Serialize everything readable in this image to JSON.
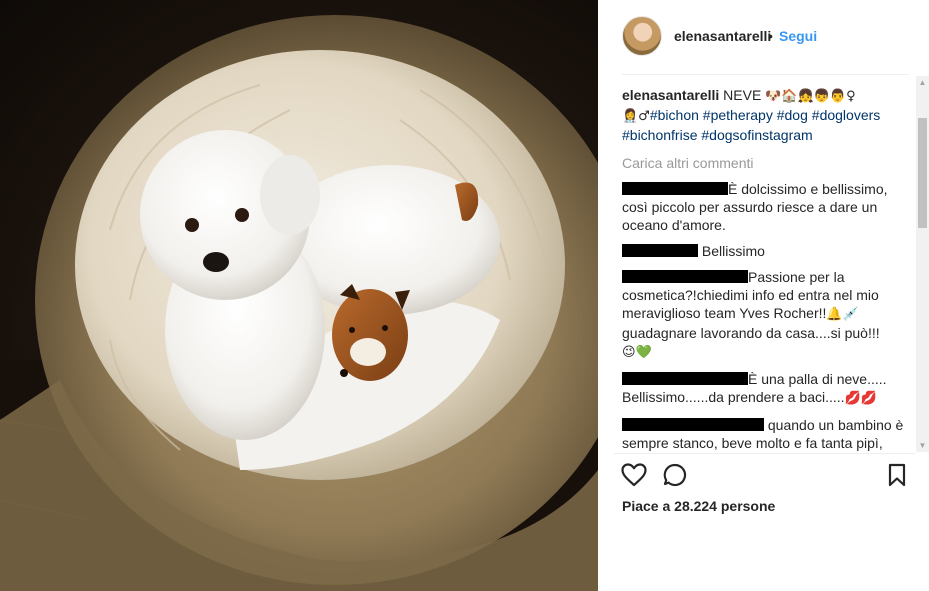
{
  "post": {
    "username": "elenasantarelli",
    "separator": "•",
    "follow_label": "Segui",
    "caption": {
      "user": "elenasantarelli",
      "text": "NEVE",
      "emoji_line1": "🐶🏠👧👦👨♀",
      "emoji_line2": "👩‍⚕♂",
      "hashtags_line1": [
        "#bichon",
        "#petherapy",
        "#dog",
        "#doglovers"
      ],
      "hashtags_line2": [
        "#bichonfrise",
        "#dogsofinstagram"
      ]
    },
    "load_more_label": "Carica altri commenti",
    "comments": [
      {
        "text": "È dolcissimo e bellissimo, così piccolo per assurdo riesce a dare un oceano d'amore."
      },
      {
        "text": "Bellissimo"
      },
      {
        "text": "Passione per la cosmetica?!chiedimi info ed entra nel mio meraviglioso team Yves Rocher!!",
        "emoji": "🔔💉",
        "text2": "guadagnare lavorando da casa....si può!!!",
        "emoji2": "😉💚"
      },
      {
        "text": "È una palla di neve..... Bellissimo......da prendere a baci.....",
        "emoji": "💋💋"
      },
      {
        "text": "quando un bambino è sempre stanco, beve molto e fa tanta pipì, bisogna tenere sotto controllo la"
      }
    ],
    "likes_text": "Piace a 28.224 persone"
  },
  "icons": {
    "like": "heart-icon",
    "comment": "comment-bubble-icon",
    "save": "bookmark-icon",
    "scroll_up": "scroll-up-arrow-icon",
    "scroll_down": "scroll-down-arrow-icon"
  },
  "colors": {
    "link_blue": "#3897f0",
    "hashtag": "#003569",
    "muted": "#999999",
    "text": "#262626"
  },
  "photo": {
    "subject": "white bichon puppy with plush fox toy in a round pet bed"
  }
}
